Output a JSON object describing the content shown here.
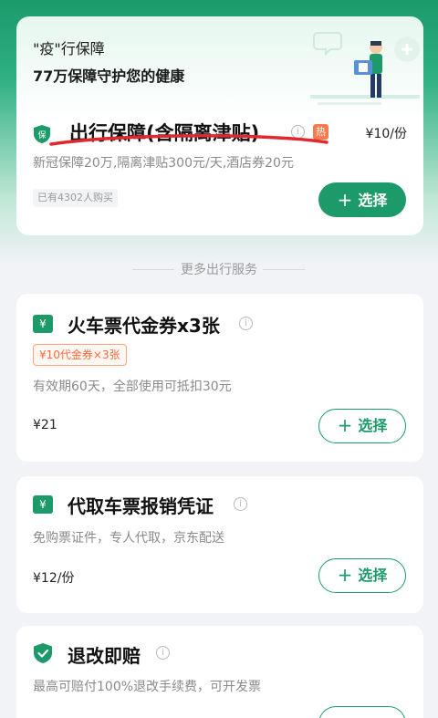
{
  "hero": {
    "title": "\"疫\"行保障",
    "subtitle": "77万保障守护您的健康"
  },
  "featured_product": {
    "icon_text": "保",
    "name": "出行保障(含隔离津贴)",
    "info_icon": "i",
    "badge": "热",
    "price": "¥10/份",
    "description": "新冠保障20万,隔离津贴300元/天,酒店券20元",
    "bought": "已有4302人购买",
    "select_label": "选择",
    "plus": "+"
  },
  "section_title": "更多出行服务",
  "services": [
    {
      "icon_text": "¥",
      "title": "火车票代金券x3张",
      "info_icon": "i",
      "tag": "¥10代金券×3张",
      "description": "有效期60天，全部使用可抵扣30元",
      "price": "¥21",
      "select_label": "选择",
      "plus": "+"
    },
    {
      "icon_text": "¥",
      "title": "代取车票报销凭证",
      "info_icon": "i",
      "description": "免购票证件，专人代取，京东配送",
      "price": "¥12/份",
      "select_label": "选择",
      "plus": "+"
    },
    {
      "icon_text": "✓",
      "title": "退改即赔",
      "info_icon": "i",
      "description": "最高可赔付100%退改手续费，可开发票"
    }
  ],
  "colors": {
    "brand_green": "#1c9a69",
    "hot_orange": "#ff7a4a",
    "coupon_orange": "#ff6a3a",
    "annotation_red": "#e0282e"
  }
}
